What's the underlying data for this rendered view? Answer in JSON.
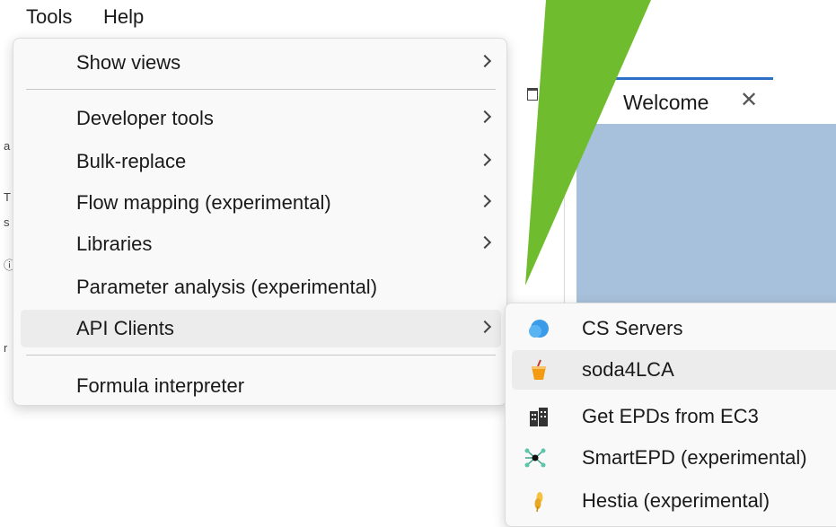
{
  "menubar": {
    "items": [
      {
        "label": "Tools"
      },
      {
        "label": "Help"
      }
    ]
  },
  "background": {
    "welcome_tab": {
      "label": "Welcome",
      "close_glyph": "✕",
      "icon": "pin-icon"
    },
    "left_edge_glyphs": [
      "a",
      "T",
      "s",
      "ⓘ",
      "r"
    ]
  },
  "tools_menu": {
    "items": [
      {
        "label": "Show views",
        "submenu": true
      },
      {
        "label": "Developer tools",
        "submenu": true
      },
      {
        "label": "Bulk-replace",
        "submenu": true
      },
      {
        "label": "Flow mapping (experimental)",
        "submenu": true
      },
      {
        "label": "Libraries",
        "submenu": true
      },
      {
        "label": "Parameter analysis (experimental)",
        "submenu": false
      },
      {
        "label": "API Clients",
        "submenu": true,
        "highlighted": true
      },
      {
        "label": "Formula interpreter",
        "submenu": false
      }
    ]
  },
  "api_clients_submenu": {
    "items": [
      {
        "label": "CS Servers",
        "icon": "cloud-icon"
      },
      {
        "label": "soda4LCA",
        "icon": "soda-cup-icon",
        "highlighted": true
      },
      {
        "label": "Get EPDs from EC3",
        "icon": "building-icon"
      },
      {
        "label": "SmartEPD (experimental)",
        "icon": "network-icon"
      },
      {
        "label": "Hestia (experimental)",
        "icon": "wheat-icon"
      }
    ]
  },
  "colors": {
    "arrow": "#6fbd2e",
    "welcome_pane": "#a7c0db",
    "tab_accent": "#2e6fc7",
    "menu_bg": "#f9f9f9",
    "highlight": "#ececec"
  }
}
